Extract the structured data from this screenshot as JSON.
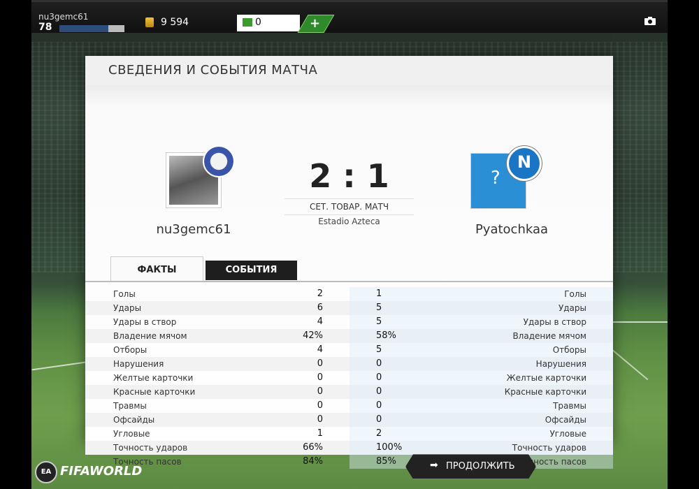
{
  "top_bar": {
    "username": "nu3gemc61",
    "level": "78",
    "xp_fraction": 0.75,
    "coins": "9 594",
    "points": "0",
    "add_label": "+"
  },
  "panel": {
    "title": "СВЕДЕНИЯ И СОБЫТИЯ МАТЧА",
    "home_name": "nu3gemc61",
    "away_name": "Pyatochkaa",
    "score": "2 : 1",
    "match_type": "СЕТ. ТОВАР. МАТЧ",
    "stadium": "Estadio Azteca",
    "away_badge_letter": "N",
    "away_avatar_q": "?"
  },
  "tabs": [
    {
      "label": "ФАКТЫ",
      "active": true
    },
    {
      "label": "СОБЫТИЯ",
      "active": false
    }
  ],
  "stats": [
    {
      "label": "Голы",
      "home": "2",
      "away": "1"
    },
    {
      "label": "Удары",
      "home": "6",
      "away": "5"
    },
    {
      "label": "Удары в створ",
      "home": "4",
      "away": "5"
    },
    {
      "label": "Владение мячом",
      "home": "42%",
      "away": "58%"
    },
    {
      "label": "Отборы",
      "home": "4",
      "away": "5"
    },
    {
      "label": "Нарушения",
      "home": "0",
      "away": "0"
    },
    {
      "label": "Желтые карточки",
      "home": "0",
      "away": "0"
    },
    {
      "label": "Красные карточки",
      "home": "0",
      "away": "0"
    },
    {
      "label": "Травмы",
      "home": "0",
      "away": "0"
    },
    {
      "label": "Офсайды",
      "home": "0",
      "away": "0"
    },
    {
      "label": "Угловые",
      "home": "1",
      "away": "2"
    },
    {
      "label": "Точность ударов",
      "home": "66%",
      "away": "100%"
    },
    {
      "label": "Точность пасов",
      "home": "84%",
      "away": "85%"
    }
  ],
  "bottom": {
    "logo_ea": "EA",
    "logo_text": "FIFAWORLD",
    "continue_arrow": "➡",
    "continue_label": "ПРОДОЛЖИТЬ"
  },
  "icons": {
    "camera": "camera-icon",
    "coin": "coin-icon",
    "points": "points-icon"
  },
  "colors": {
    "xp_bar": "#2d4e7a",
    "add_button": "#2f8a2a",
    "away_avatar": "#2b8fd6"
  }
}
